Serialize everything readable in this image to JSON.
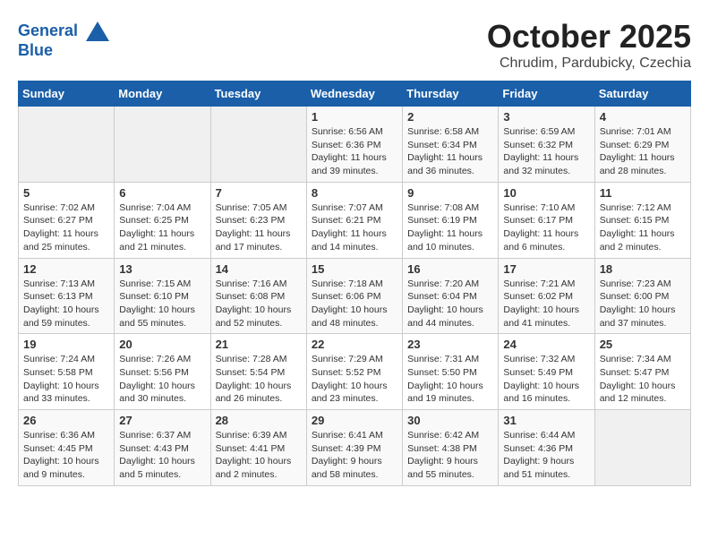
{
  "header": {
    "logo_line1": "General",
    "logo_line2": "Blue",
    "month": "October 2025",
    "location": "Chrudim, Pardubicky, Czechia"
  },
  "weekdays": [
    "Sunday",
    "Monday",
    "Tuesday",
    "Wednesday",
    "Thursday",
    "Friday",
    "Saturday"
  ],
  "weeks": [
    [
      {
        "day": "",
        "info": ""
      },
      {
        "day": "",
        "info": ""
      },
      {
        "day": "",
        "info": ""
      },
      {
        "day": "1",
        "info": "Sunrise: 6:56 AM\nSunset: 6:36 PM\nDaylight: 11 hours\nand 39 minutes."
      },
      {
        "day": "2",
        "info": "Sunrise: 6:58 AM\nSunset: 6:34 PM\nDaylight: 11 hours\nand 36 minutes."
      },
      {
        "day": "3",
        "info": "Sunrise: 6:59 AM\nSunset: 6:32 PM\nDaylight: 11 hours\nand 32 minutes."
      },
      {
        "day": "4",
        "info": "Sunrise: 7:01 AM\nSunset: 6:29 PM\nDaylight: 11 hours\nand 28 minutes."
      }
    ],
    [
      {
        "day": "5",
        "info": "Sunrise: 7:02 AM\nSunset: 6:27 PM\nDaylight: 11 hours\nand 25 minutes."
      },
      {
        "day": "6",
        "info": "Sunrise: 7:04 AM\nSunset: 6:25 PM\nDaylight: 11 hours\nand 21 minutes."
      },
      {
        "day": "7",
        "info": "Sunrise: 7:05 AM\nSunset: 6:23 PM\nDaylight: 11 hours\nand 17 minutes."
      },
      {
        "day": "8",
        "info": "Sunrise: 7:07 AM\nSunset: 6:21 PM\nDaylight: 11 hours\nand 14 minutes."
      },
      {
        "day": "9",
        "info": "Sunrise: 7:08 AM\nSunset: 6:19 PM\nDaylight: 11 hours\nand 10 minutes."
      },
      {
        "day": "10",
        "info": "Sunrise: 7:10 AM\nSunset: 6:17 PM\nDaylight: 11 hours\nand 6 minutes."
      },
      {
        "day": "11",
        "info": "Sunrise: 7:12 AM\nSunset: 6:15 PM\nDaylight: 11 hours\nand 2 minutes."
      }
    ],
    [
      {
        "day": "12",
        "info": "Sunrise: 7:13 AM\nSunset: 6:13 PM\nDaylight: 10 hours\nand 59 minutes."
      },
      {
        "day": "13",
        "info": "Sunrise: 7:15 AM\nSunset: 6:10 PM\nDaylight: 10 hours\nand 55 minutes."
      },
      {
        "day": "14",
        "info": "Sunrise: 7:16 AM\nSunset: 6:08 PM\nDaylight: 10 hours\nand 52 minutes."
      },
      {
        "day": "15",
        "info": "Sunrise: 7:18 AM\nSunset: 6:06 PM\nDaylight: 10 hours\nand 48 minutes."
      },
      {
        "day": "16",
        "info": "Sunrise: 7:20 AM\nSunset: 6:04 PM\nDaylight: 10 hours\nand 44 minutes."
      },
      {
        "day": "17",
        "info": "Sunrise: 7:21 AM\nSunset: 6:02 PM\nDaylight: 10 hours\nand 41 minutes."
      },
      {
        "day": "18",
        "info": "Sunrise: 7:23 AM\nSunset: 6:00 PM\nDaylight: 10 hours\nand 37 minutes."
      }
    ],
    [
      {
        "day": "19",
        "info": "Sunrise: 7:24 AM\nSunset: 5:58 PM\nDaylight: 10 hours\nand 33 minutes."
      },
      {
        "day": "20",
        "info": "Sunrise: 7:26 AM\nSunset: 5:56 PM\nDaylight: 10 hours\nand 30 minutes."
      },
      {
        "day": "21",
        "info": "Sunrise: 7:28 AM\nSunset: 5:54 PM\nDaylight: 10 hours\nand 26 minutes."
      },
      {
        "day": "22",
        "info": "Sunrise: 7:29 AM\nSunset: 5:52 PM\nDaylight: 10 hours\nand 23 minutes."
      },
      {
        "day": "23",
        "info": "Sunrise: 7:31 AM\nSunset: 5:50 PM\nDaylight: 10 hours\nand 19 minutes."
      },
      {
        "day": "24",
        "info": "Sunrise: 7:32 AM\nSunset: 5:49 PM\nDaylight: 10 hours\nand 16 minutes."
      },
      {
        "day": "25",
        "info": "Sunrise: 7:34 AM\nSunset: 5:47 PM\nDaylight: 10 hours\nand 12 minutes."
      }
    ],
    [
      {
        "day": "26",
        "info": "Sunrise: 6:36 AM\nSunset: 4:45 PM\nDaylight: 10 hours\nand 9 minutes."
      },
      {
        "day": "27",
        "info": "Sunrise: 6:37 AM\nSunset: 4:43 PM\nDaylight: 10 hours\nand 5 minutes."
      },
      {
        "day": "28",
        "info": "Sunrise: 6:39 AM\nSunset: 4:41 PM\nDaylight: 10 hours\nand 2 minutes."
      },
      {
        "day": "29",
        "info": "Sunrise: 6:41 AM\nSunset: 4:39 PM\nDaylight: 9 hours\nand 58 minutes."
      },
      {
        "day": "30",
        "info": "Sunrise: 6:42 AM\nSunset: 4:38 PM\nDaylight: 9 hours\nand 55 minutes."
      },
      {
        "day": "31",
        "info": "Sunrise: 6:44 AM\nSunset: 4:36 PM\nDaylight: 9 hours\nand 51 minutes."
      },
      {
        "day": "",
        "info": ""
      }
    ]
  ]
}
